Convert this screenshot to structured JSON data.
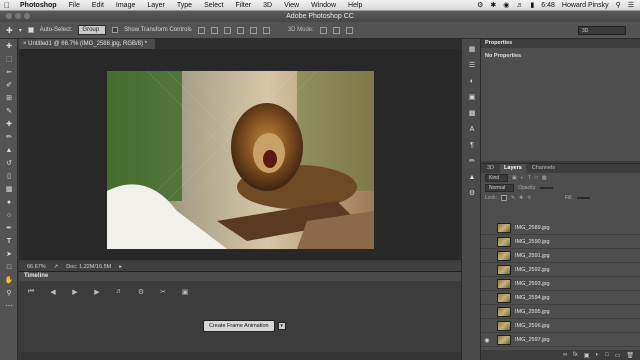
{
  "menubar": {
    "app": "Photoshop",
    "items": [
      "File",
      "Edit",
      "Image",
      "Layer",
      "Type",
      "Select",
      "Filter",
      "3D",
      "View",
      "Window",
      "Help"
    ],
    "time": "6:48",
    "user": "Howard Pinsky"
  },
  "window": {
    "title": "Adobe Photoshop CC"
  },
  "options": {
    "auto_select_label": "Auto-Select:",
    "auto_select_value": "Group",
    "transform_label": "Show Transform Controls",
    "mode_3d": "3D Mode:",
    "workspace": "3D"
  },
  "document": {
    "tab": "Untitled1 @ 66.7% (IMG_2588.jpg, RGB/8) *",
    "zoom": "66.67%",
    "doc_size": "Doc: 1.22M/16.5M"
  },
  "timeline": {
    "title": "Timeline",
    "create_button": "Create Frame Animation"
  },
  "properties": {
    "title": "Properties",
    "empty": "No Properties"
  },
  "layers_panel": {
    "tabs": [
      "3D",
      "Layers",
      "Channels"
    ],
    "kind": "Kind",
    "blend": "Normal",
    "opacity_label": "Opacity:",
    "lock_label": "Lock:",
    "fill_label": "Fill:",
    "layers": [
      "IMG_2589.jpg",
      "IMG_2590.jpg",
      "IMG_2591.jpg",
      "IMG_2592.jpg",
      "IMG_2593.jpg",
      "IMG_2594.jpg",
      "IMG_2595.jpg",
      "IMG_2596.jpg",
      "IMG_2597.jpg"
    ]
  }
}
